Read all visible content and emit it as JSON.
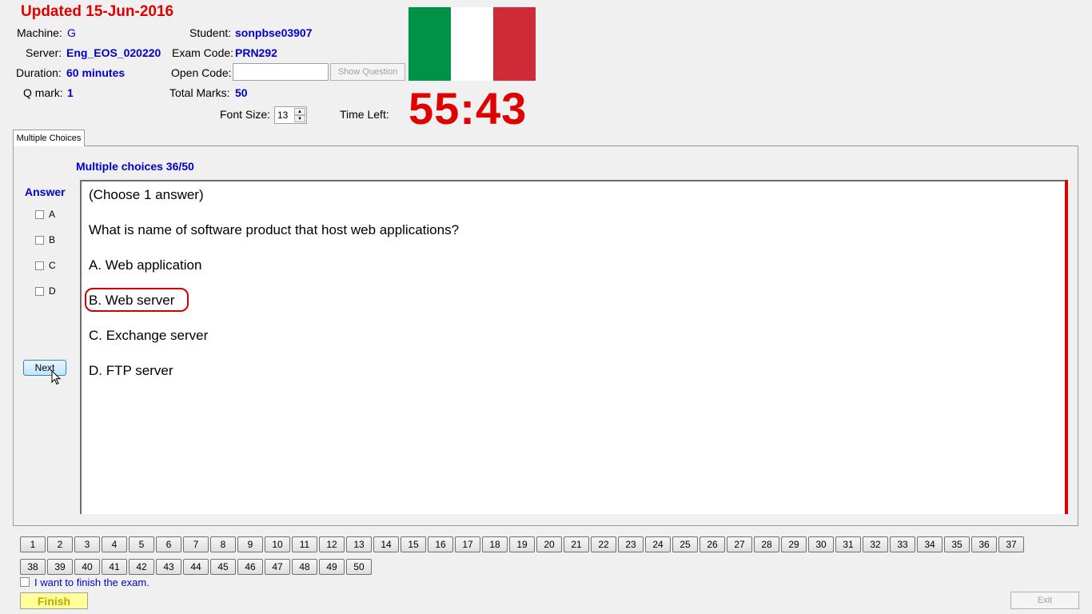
{
  "header": {
    "updated": "Updated 15-Jun-2016",
    "machine_label": "Machine:",
    "machine_value": "G",
    "server_label": "Server:",
    "server_value": "Eng_EOS_020220",
    "duration_label": "Duration:",
    "duration_value": "60 minutes",
    "qmark_label": "Q mark:",
    "qmark_value": "1",
    "student_label": "Student:",
    "student_value": "sonpbse03907",
    "exam_code_label": "Exam Code:",
    "exam_code_value": "PRN292",
    "open_code_label": "Open Code:",
    "open_code_value": "",
    "show_question_button": "Show Question",
    "total_marks_label": "Total Marks:",
    "total_marks_value": "50",
    "font_size_label": "Font Size:",
    "font_size_value": "13",
    "time_left_label": "Time Left:",
    "time_left_value": "55:43"
  },
  "flag_colors": [
    "#009246",
    "#ffffff",
    "#ce2b37"
  ],
  "tabs": [
    "Multiple Choices"
  ],
  "question": {
    "progress": "Multiple choices 36/50",
    "instruction": "(Choose 1 answer)",
    "text": "What is name of software product that host web applications?",
    "options": [
      "A.  Web application",
      "B.  Web server",
      "C.  Exchange server",
      "D.  FTP server"
    ]
  },
  "answer": {
    "title": "Answer",
    "choices": [
      "A",
      "B",
      "C",
      "D"
    ],
    "next_button": "Next"
  },
  "nav": {
    "row1": [
      "1",
      "2",
      "3",
      "4",
      "5",
      "6",
      "7",
      "8",
      "9",
      "10",
      "11",
      "12",
      "13",
      "14",
      "15",
      "16",
      "17",
      "18",
      "19",
      "20",
      "21",
      "22",
      "23",
      "24",
      "25",
      "26",
      "27",
      "28",
      "29",
      "30",
      "31",
      "32",
      "33",
      "34",
      "35",
      "36",
      "37"
    ],
    "row2": [
      "38",
      "39",
      "40",
      "41",
      "42",
      "43",
      "44",
      "45",
      "46",
      "47",
      "48",
      "49",
      "50"
    ]
  },
  "footer": {
    "finish_checkbox_label": "I want to finish the exam.",
    "finish_button": "Finish",
    "exit_button": "Exit"
  }
}
